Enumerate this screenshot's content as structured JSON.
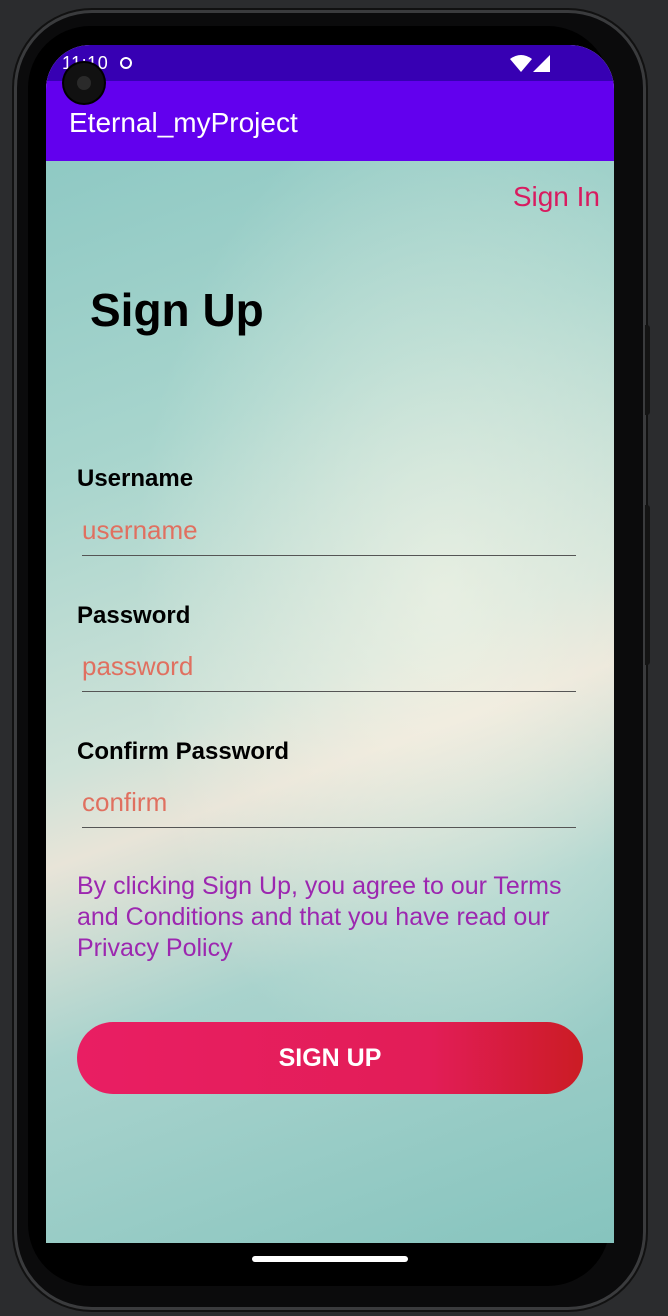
{
  "status_bar": {
    "time": "11:10"
  },
  "app_bar": {
    "title": "Eternal_myProject"
  },
  "signin_link": "Sign In",
  "page_title": "Sign Up",
  "fields": [
    {
      "label": "Username",
      "placeholder": "username"
    },
    {
      "label": "Password",
      "placeholder": "password"
    },
    {
      "label": "Confirm Password",
      "placeholder": "confirm"
    }
  ],
  "terms_text": "By clicking Sign Up, you agree to our Terms and Conditions and that you have read our Privacy Policy",
  "signup_button": "SIGN UP",
  "colors": {
    "status_bar": "#3700b3",
    "app_bar": "#6200ee",
    "accent": "#e91e63",
    "terms": "#9c27b0",
    "placeholder": "#e07060"
  },
  "icons": [
    "wifi-icon",
    "cellular-signal-icon",
    "camera-icon",
    "notification-dot-icon"
  ]
}
